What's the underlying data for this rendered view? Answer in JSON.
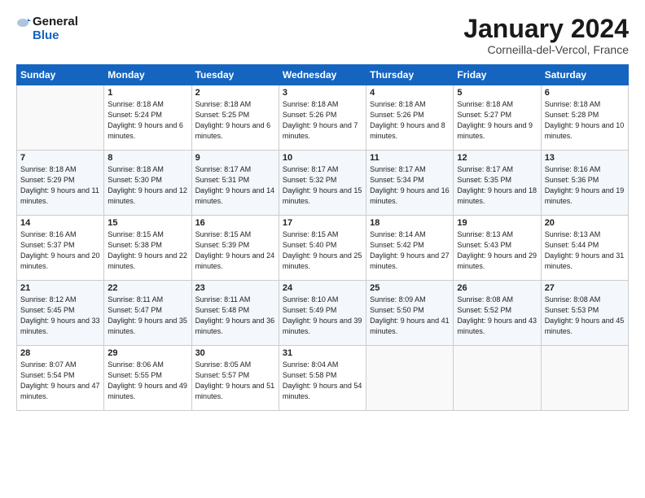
{
  "logo": {
    "line1": "General",
    "line2": "Blue"
  },
  "title": "January 2024",
  "location": "Corneilla-del-Vercol, France",
  "weekdays": [
    "Sunday",
    "Monday",
    "Tuesday",
    "Wednesday",
    "Thursday",
    "Friday",
    "Saturday"
  ],
  "weeks": [
    [
      {
        "day": "",
        "sunrise": "",
        "sunset": "",
        "daylight": ""
      },
      {
        "day": "1",
        "sunrise": "Sunrise: 8:18 AM",
        "sunset": "Sunset: 5:24 PM",
        "daylight": "Daylight: 9 hours and 6 minutes."
      },
      {
        "day": "2",
        "sunrise": "Sunrise: 8:18 AM",
        "sunset": "Sunset: 5:25 PM",
        "daylight": "Daylight: 9 hours and 6 minutes."
      },
      {
        "day": "3",
        "sunrise": "Sunrise: 8:18 AM",
        "sunset": "Sunset: 5:26 PM",
        "daylight": "Daylight: 9 hours and 7 minutes."
      },
      {
        "day": "4",
        "sunrise": "Sunrise: 8:18 AM",
        "sunset": "Sunset: 5:26 PM",
        "daylight": "Daylight: 9 hours and 8 minutes."
      },
      {
        "day": "5",
        "sunrise": "Sunrise: 8:18 AM",
        "sunset": "Sunset: 5:27 PM",
        "daylight": "Daylight: 9 hours and 9 minutes."
      },
      {
        "day": "6",
        "sunrise": "Sunrise: 8:18 AM",
        "sunset": "Sunset: 5:28 PM",
        "daylight": "Daylight: 9 hours and 10 minutes."
      }
    ],
    [
      {
        "day": "7",
        "sunrise": "Sunrise: 8:18 AM",
        "sunset": "Sunset: 5:29 PM",
        "daylight": "Daylight: 9 hours and 11 minutes."
      },
      {
        "day": "8",
        "sunrise": "Sunrise: 8:18 AM",
        "sunset": "Sunset: 5:30 PM",
        "daylight": "Daylight: 9 hours and 12 minutes."
      },
      {
        "day": "9",
        "sunrise": "Sunrise: 8:17 AM",
        "sunset": "Sunset: 5:31 PM",
        "daylight": "Daylight: 9 hours and 14 minutes."
      },
      {
        "day": "10",
        "sunrise": "Sunrise: 8:17 AM",
        "sunset": "Sunset: 5:32 PM",
        "daylight": "Daylight: 9 hours and 15 minutes."
      },
      {
        "day": "11",
        "sunrise": "Sunrise: 8:17 AM",
        "sunset": "Sunset: 5:34 PM",
        "daylight": "Daylight: 9 hours and 16 minutes."
      },
      {
        "day": "12",
        "sunrise": "Sunrise: 8:17 AM",
        "sunset": "Sunset: 5:35 PM",
        "daylight": "Daylight: 9 hours and 18 minutes."
      },
      {
        "day": "13",
        "sunrise": "Sunrise: 8:16 AM",
        "sunset": "Sunset: 5:36 PM",
        "daylight": "Daylight: 9 hours and 19 minutes."
      }
    ],
    [
      {
        "day": "14",
        "sunrise": "Sunrise: 8:16 AM",
        "sunset": "Sunset: 5:37 PM",
        "daylight": "Daylight: 9 hours and 20 minutes."
      },
      {
        "day": "15",
        "sunrise": "Sunrise: 8:15 AM",
        "sunset": "Sunset: 5:38 PM",
        "daylight": "Daylight: 9 hours and 22 minutes."
      },
      {
        "day": "16",
        "sunrise": "Sunrise: 8:15 AM",
        "sunset": "Sunset: 5:39 PM",
        "daylight": "Daylight: 9 hours and 24 minutes."
      },
      {
        "day": "17",
        "sunrise": "Sunrise: 8:15 AM",
        "sunset": "Sunset: 5:40 PM",
        "daylight": "Daylight: 9 hours and 25 minutes."
      },
      {
        "day": "18",
        "sunrise": "Sunrise: 8:14 AM",
        "sunset": "Sunset: 5:42 PM",
        "daylight": "Daylight: 9 hours and 27 minutes."
      },
      {
        "day": "19",
        "sunrise": "Sunrise: 8:13 AM",
        "sunset": "Sunset: 5:43 PM",
        "daylight": "Daylight: 9 hours and 29 minutes."
      },
      {
        "day": "20",
        "sunrise": "Sunrise: 8:13 AM",
        "sunset": "Sunset: 5:44 PM",
        "daylight": "Daylight: 9 hours and 31 minutes."
      }
    ],
    [
      {
        "day": "21",
        "sunrise": "Sunrise: 8:12 AM",
        "sunset": "Sunset: 5:45 PM",
        "daylight": "Daylight: 9 hours and 33 minutes."
      },
      {
        "day": "22",
        "sunrise": "Sunrise: 8:11 AM",
        "sunset": "Sunset: 5:47 PM",
        "daylight": "Daylight: 9 hours and 35 minutes."
      },
      {
        "day": "23",
        "sunrise": "Sunrise: 8:11 AM",
        "sunset": "Sunset: 5:48 PM",
        "daylight": "Daylight: 9 hours and 36 minutes."
      },
      {
        "day": "24",
        "sunrise": "Sunrise: 8:10 AM",
        "sunset": "Sunset: 5:49 PM",
        "daylight": "Daylight: 9 hours and 39 minutes."
      },
      {
        "day": "25",
        "sunrise": "Sunrise: 8:09 AM",
        "sunset": "Sunset: 5:50 PM",
        "daylight": "Daylight: 9 hours and 41 minutes."
      },
      {
        "day": "26",
        "sunrise": "Sunrise: 8:08 AM",
        "sunset": "Sunset: 5:52 PM",
        "daylight": "Daylight: 9 hours and 43 minutes."
      },
      {
        "day": "27",
        "sunrise": "Sunrise: 8:08 AM",
        "sunset": "Sunset: 5:53 PM",
        "daylight": "Daylight: 9 hours and 45 minutes."
      }
    ],
    [
      {
        "day": "28",
        "sunrise": "Sunrise: 8:07 AM",
        "sunset": "Sunset: 5:54 PM",
        "daylight": "Daylight: 9 hours and 47 minutes."
      },
      {
        "day": "29",
        "sunrise": "Sunrise: 8:06 AM",
        "sunset": "Sunset: 5:55 PM",
        "daylight": "Daylight: 9 hours and 49 minutes."
      },
      {
        "day": "30",
        "sunrise": "Sunrise: 8:05 AM",
        "sunset": "Sunset: 5:57 PM",
        "daylight": "Daylight: 9 hours and 51 minutes."
      },
      {
        "day": "31",
        "sunrise": "Sunrise: 8:04 AM",
        "sunset": "Sunset: 5:58 PM",
        "daylight": "Daylight: 9 hours and 54 minutes."
      },
      {
        "day": "",
        "sunrise": "",
        "sunset": "",
        "daylight": ""
      },
      {
        "day": "",
        "sunrise": "",
        "sunset": "",
        "daylight": ""
      },
      {
        "day": "",
        "sunrise": "",
        "sunset": "",
        "daylight": ""
      }
    ]
  ]
}
